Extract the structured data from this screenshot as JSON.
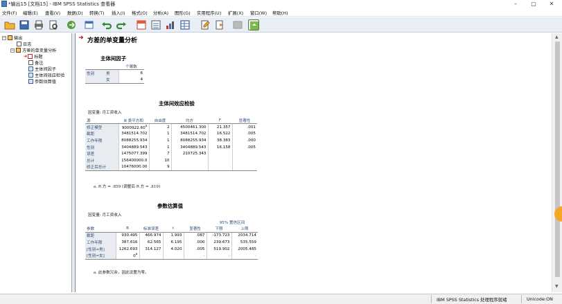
{
  "window": {
    "title": "*输出15 [文档15] - IBM SPSS Statistics 查看器"
  },
  "menu": [
    "文件(F)",
    "编辑(E)",
    "查看(V)",
    "数据(D)",
    "转换(T)",
    "插入(I)",
    "格式(O)",
    "分析(A)",
    "图形(G)",
    "实用程序(U)",
    "扩展(X)",
    "窗口(W)",
    "帮助(H)"
  ],
  "nav": {
    "root": "输出",
    "log": "日志",
    "proc": "方差的单变量分析",
    "items": [
      "标题",
      "备注",
      "主体间因子",
      "主体间效应检验",
      "参数估算值"
    ]
  },
  "content": {
    "title": "方差的单变量分析",
    "bsf": {
      "title": "主体间因子",
      "col_header": "个案数",
      "row_group": "性别",
      "rows": [
        {
          "label": "男",
          "n": "6"
        },
        {
          "label": "女",
          "n": "4"
        }
      ]
    },
    "tbse": {
      "title": "主体间效应检验",
      "dep_label": "因变量:   月工资收入",
      "headers": [
        "源",
        "Ⅲ 类平方和",
        "自由度",
        "均方",
        "F",
        "显著性"
      ],
      "rows": [
        [
          "修正模型",
          "9000922.60",
          "2",
          "4500461.300",
          "21.357",
          ".001"
        ],
        [
          "截距",
          "3481514.702",
          "1",
          "3481514.702",
          "16.522",
          ".005"
        ],
        [
          "工作年限",
          "8088255.934",
          "1",
          "8088255.934",
          "38.383",
          ".000"
        ],
        [
          "性别",
          "3404889.543",
          "1",
          "3404889.543",
          "16.158",
          ".005"
        ],
        [
          "误差",
          "1475077.399",
          "7",
          "210725.343",
          "",
          ""
        ],
        [
          "总计",
          "156400000.0",
          "10",
          "",
          "",
          ""
        ],
        [
          "修正后总计",
          "10476000.00",
          "9",
          "",
          "",
          ""
        ]
      ],
      "superscript": "a",
      "footnote": "a. R 方 = .859 (调整后 R 方 = .819)"
    },
    "params": {
      "title": "参数估算值",
      "dep_label": "因变量:   月工资收入",
      "ci_header": "95% 置信区间",
      "headers": [
        "参数",
        "B",
        "标准误差",
        "t",
        "显著性",
        "下限",
        "上限"
      ],
      "rows": [
        [
          "截距",
          "930.495",
          "466.974",
          "1.993",
          ".087",
          "-173.723",
          "2034.714"
        ],
        [
          "工作年限",
          "387.616",
          "62.565",
          "6.195",
          ".000",
          "239.673",
          "535.559"
        ],
        [
          "[性别=男]",
          "1262.693",
          "314.127",
          "4.020",
          ".005",
          "519.902",
          "2005.485"
        ],
        [
          "[性别=女]",
          "0",
          "",
          "",
          ".",
          ".",
          "."
        ]
      ],
      "superscript": "a",
      "footnote": "a. 此参数冗余，因此设置为零。"
    }
  },
  "status": {
    "processor": "IBM SPSS Statistics 处理程序就绪",
    "unicode": "Unicode:ON"
  },
  "colors": {
    "toolbar_bg": "#e9eef6",
    "pivot_label": "#2f4e7a",
    "title_arrow": "#cc0000"
  }
}
